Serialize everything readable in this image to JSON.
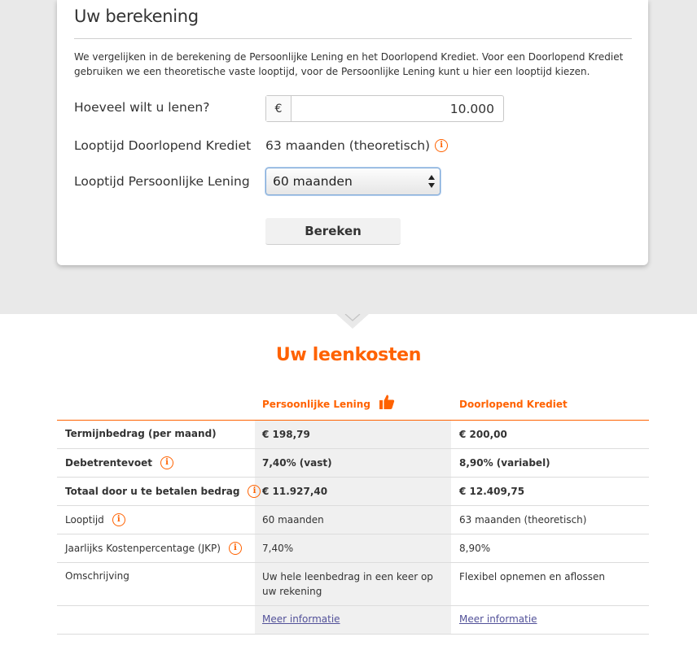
{
  "calculator": {
    "title": "Uw berekening",
    "intro": "We vergelijken in de berekening de Persoonlijke Lening en het Doorlopend Krediet. Voor een Doorlopend Krediet gebruiken we een theoretische vaste looptijd, voor de Persoonlijke Lening kunt u hier een looptijd kiezen.",
    "amount_label": "Hoeveel wilt u lenen?",
    "currency_symbol": "€",
    "amount_value": "10.000",
    "revolving_term_label": "Looptijd Doorlopend Krediet",
    "revolving_term_value": "63 maanden (theoretisch)",
    "personal_term_label": "Looptijd Persoonlijke Lening",
    "personal_term_selected": "60 maanden",
    "calculate_button": "Bereken"
  },
  "results": {
    "title": "Uw leenkosten",
    "columns": [
      "Persoonlijke Lening",
      "Doorlopend Krediet"
    ],
    "recommended_icon": "thumbs-up-icon",
    "rows": [
      {
        "label": "Termijnbedrag (per maand)",
        "bold": true,
        "info": false,
        "personal": "€ 198,79",
        "revolving": "€ 200,00"
      },
      {
        "label": "Debetrentevoet",
        "bold": true,
        "info": true,
        "personal": "7,40% (vast)",
        "revolving": "8,90% (variabel)"
      },
      {
        "label": "Totaal door u te betalen bedrag",
        "bold": true,
        "info": true,
        "personal": "€ 11.927,40",
        "revolving": "€ 12.409,75"
      },
      {
        "label": "Looptijd",
        "bold": false,
        "info": true,
        "personal": "60 maanden",
        "revolving": "63 maanden (theoretisch)"
      },
      {
        "label": "Jaarlijks Kostenpercentage (JKP)",
        "bold": false,
        "info": true,
        "personal": "7,40%",
        "revolving": "8,90%"
      },
      {
        "label": "Omschrijving",
        "bold": false,
        "info": false,
        "personal": "Uw hele leenbedrag in een keer op uw rekening",
        "revolving": "Flexibel opnemen en aflossen"
      }
    ],
    "more_info_label": "Meer informatie"
  },
  "colors": {
    "accent": "#ff6200",
    "background_band": "#e9e9e9",
    "shaded_column": "#f0f0f0",
    "link": "#525199"
  }
}
